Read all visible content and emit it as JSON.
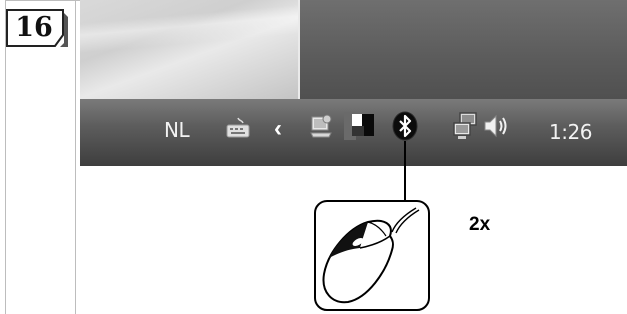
{
  "step": {
    "number": "16"
  },
  "taskbar": {
    "language": "NL",
    "clock": "1:26",
    "icons": [
      "keyboard-icon",
      "show-hidden-icons-chevron",
      "network-app-icon",
      "monitor-icon",
      "bluetooth-icon",
      "network-connection-icon",
      "speaker-volume-icon"
    ]
  },
  "instruction": {
    "click_count": "2x",
    "mouse_icon": "mouse-left-button-icon"
  }
}
